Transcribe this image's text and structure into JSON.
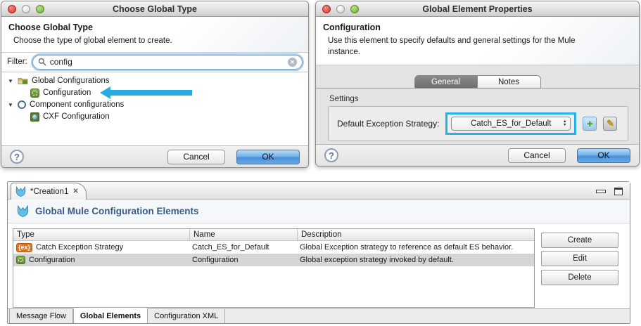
{
  "dialog_choose": {
    "window_title": "Choose Global Type",
    "heading": "Choose Global Type",
    "subtitle": "Choose the type of global element to create.",
    "filter_label": "Filter:",
    "filter_value": "config",
    "tree": {
      "items": [
        {
          "label": "Global Configurations"
        },
        {
          "label": "Configuration"
        },
        {
          "label": "Component configurations"
        },
        {
          "label": "CXF Configuration"
        }
      ]
    },
    "cancel_label": "Cancel",
    "ok_label": "OK"
  },
  "dialog_properties": {
    "window_title": "Global Element Properties",
    "heading": "Configuration",
    "description": "Use this element to specify defaults and general settings for the Mule instance.",
    "tabs": {
      "general": "General",
      "notes": "Notes"
    },
    "settings_label": "Settings",
    "field_label": "Default Exception Strategy:",
    "dropdown_value": "Catch_ES_for_Default",
    "cancel_label": "Cancel",
    "ok_label": "OK"
  },
  "editor": {
    "tab_label": "*Creation1",
    "header_title": "Global Mule Configuration Elements",
    "table": {
      "columns": [
        "Type",
        "Name",
        "Description"
      ],
      "rows": [
        {
          "type": "Catch Exception Strategy",
          "name": "Catch_ES_for_Default",
          "description": "Global Exception strategy to reference as default ES behavior."
        },
        {
          "type": "Configuration",
          "name": "Configuration",
          "description": "Global exception strategy invoked by default."
        }
      ]
    },
    "action_buttons": [
      "Create",
      "Edit",
      "Delete"
    ],
    "bottom_tabs": [
      "Message Flow",
      "Global Elements",
      "Configuration XML"
    ],
    "active_bottom_tab": "Global Elements"
  },
  "icons": {
    "help": "?",
    "clear": "✕",
    "close": "✕",
    "disclosure": "▼",
    "dropdown_up": "▲",
    "dropdown_down": "▼",
    "plus": "+",
    "pencil": "✎",
    "ex_badge": "{ex}"
  },
  "colors": {
    "ok_button_blue": "#4a90d9",
    "highlight_cyan": "#27b3e6",
    "arrow_cyan": "#29abe2",
    "ex_badge_orange": "#e2711d",
    "config_icon_green": "#5d8a2e",
    "mule_logo_blue": "#63bfe8",
    "editor_title_text": "#3a5a85",
    "selected_row_gray": "#d5d5d5"
  }
}
